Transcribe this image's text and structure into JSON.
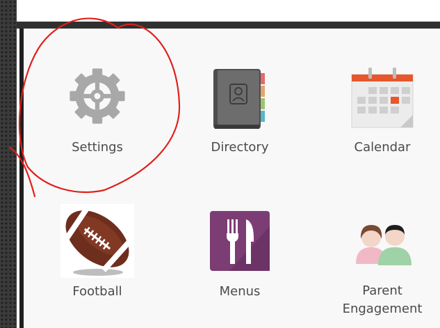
{
  "apps": [
    {
      "label": "Settings",
      "icon": "gear-icon"
    },
    {
      "label": "Directory",
      "icon": "address-book-icon"
    },
    {
      "label": "Calendar",
      "icon": "calendar-icon"
    },
    {
      "label": "Football",
      "icon": "football-icon"
    },
    {
      "label": "Menus",
      "icon": "fork-knife-icon"
    },
    {
      "label": "Parent\nEngagement",
      "icon": "parents-icon"
    }
  ],
  "colors": {
    "annotation": "#e0201b",
    "calendar_accent": "#e8562c",
    "menus_bg": "#7b3d74",
    "label_text": "#4a4a4a"
  }
}
